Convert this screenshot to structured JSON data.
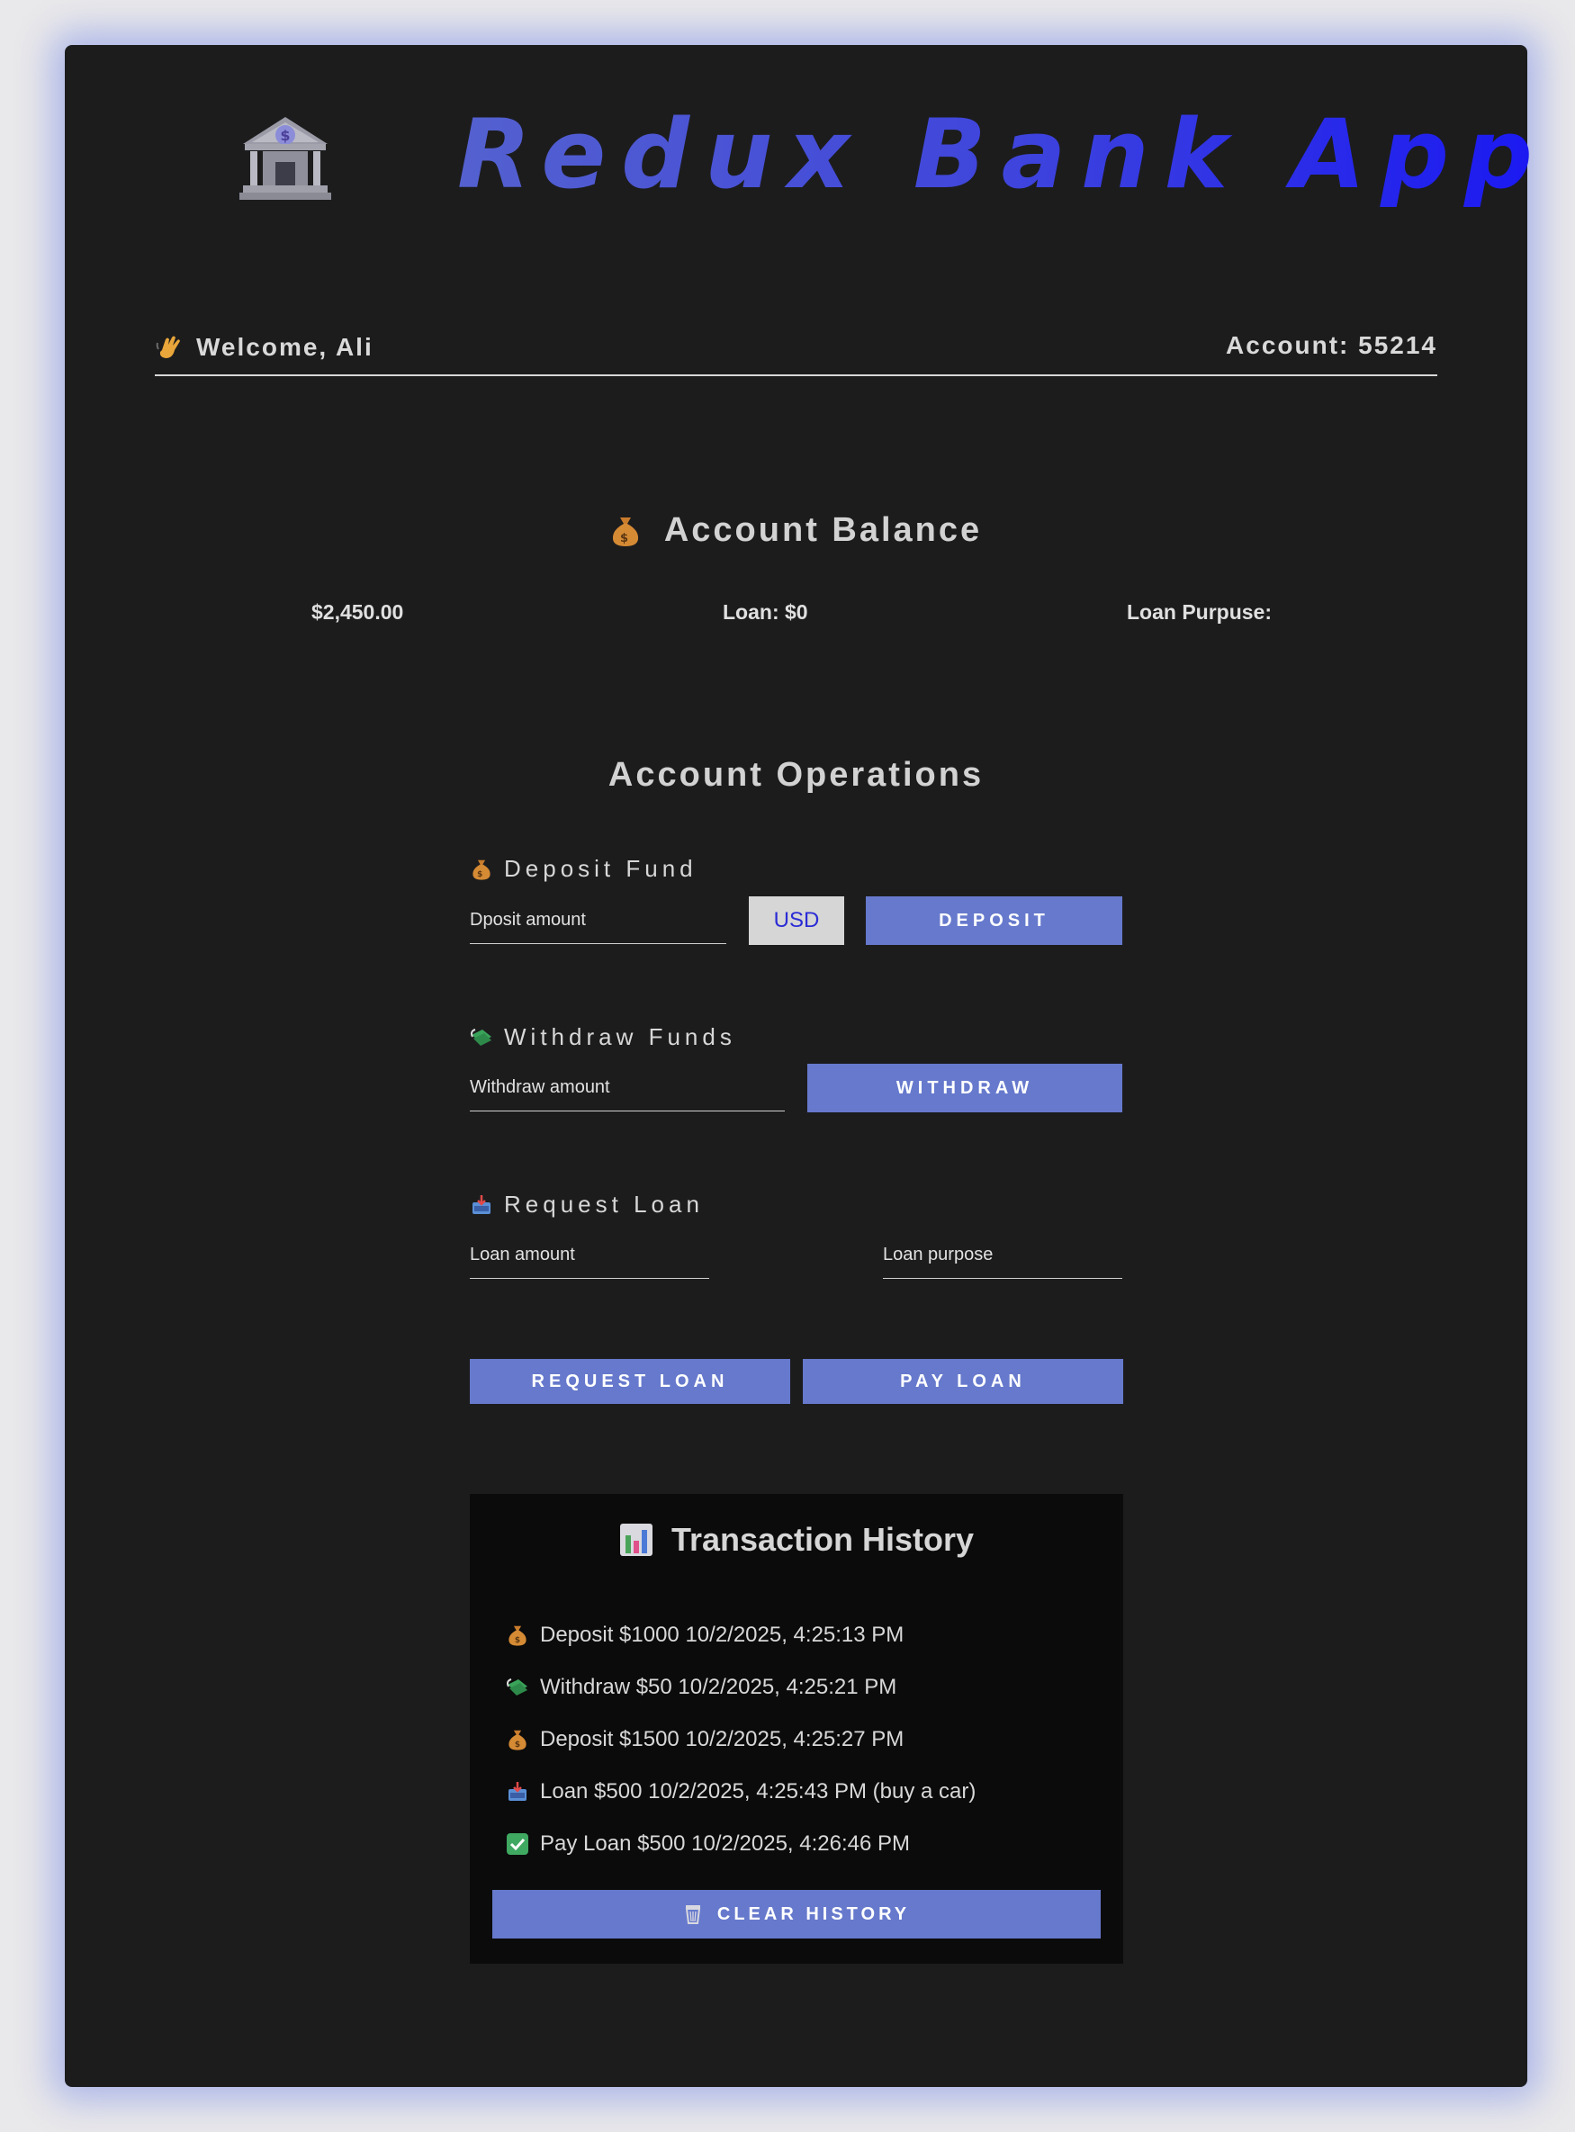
{
  "header": {
    "title": "Redux Bank App",
    "logo_icon": "bank-icon"
  },
  "user_bar": {
    "welcome": "Welcome, Ali",
    "account": "Account: 55214",
    "wave_icon": "waving-hand-icon"
  },
  "balance": {
    "heading": "Account Balance",
    "amount": "$2,450.00",
    "loan": "Loan: $0",
    "loan_purpose": "Loan Purpuse:"
  },
  "operations": {
    "heading": "Account Operations",
    "deposit": {
      "label": "Deposit Fund",
      "placeholder": "Dposit amount",
      "currency": "USD",
      "button": "Deposit"
    },
    "withdraw": {
      "label": "Withdraw Funds",
      "placeholder": "Withdraw amount",
      "button": "Withdraw"
    },
    "loan": {
      "label": "Request Loan",
      "amount_placeholder": "Loan amount",
      "purpose_placeholder": "Loan purpose",
      "request_button": "Request Loan",
      "pay_button": "Pay Loan"
    }
  },
  "history": {
    "title": "Transaction History",
    "items": [
      {
        "icon": "moneybag-icon",
        "text": "Deposit $1000 10/2/2025, 4:25:13 PM"
      },
      {
        "icon": "money-wings-icon",
        "text": "Withdraw $50 10/2/2025, 4:25:21 PM"
      },
      {
        "icon": "moneybag-icon",
        "text": "Deposit $1500 10/2/2025, 4:25:27 PM"
      },
      {
        "icon": "inbox-tray-icon",
        "text": "Loan $500 10/2/2025, 4:25:43 PM (buy a car)"
      },
      {
        "icon": "check-mark-icon",
        "text": "Pay Loan $500 10/2/2025, 4:26:46 PM"
      }
    ],
    "clear_button": "Clear History"
  },
  "colors": {
    "page_bg": "#e9e8ea",
    "card_bg": "#1c1c1d",
    "accent_button": "#6679cc",
    "title_gradient_start": "#5461cf",
    "title_gradient_end": "#1a18f2",
    "history_bg": "#0b0b0b"
  }
}
